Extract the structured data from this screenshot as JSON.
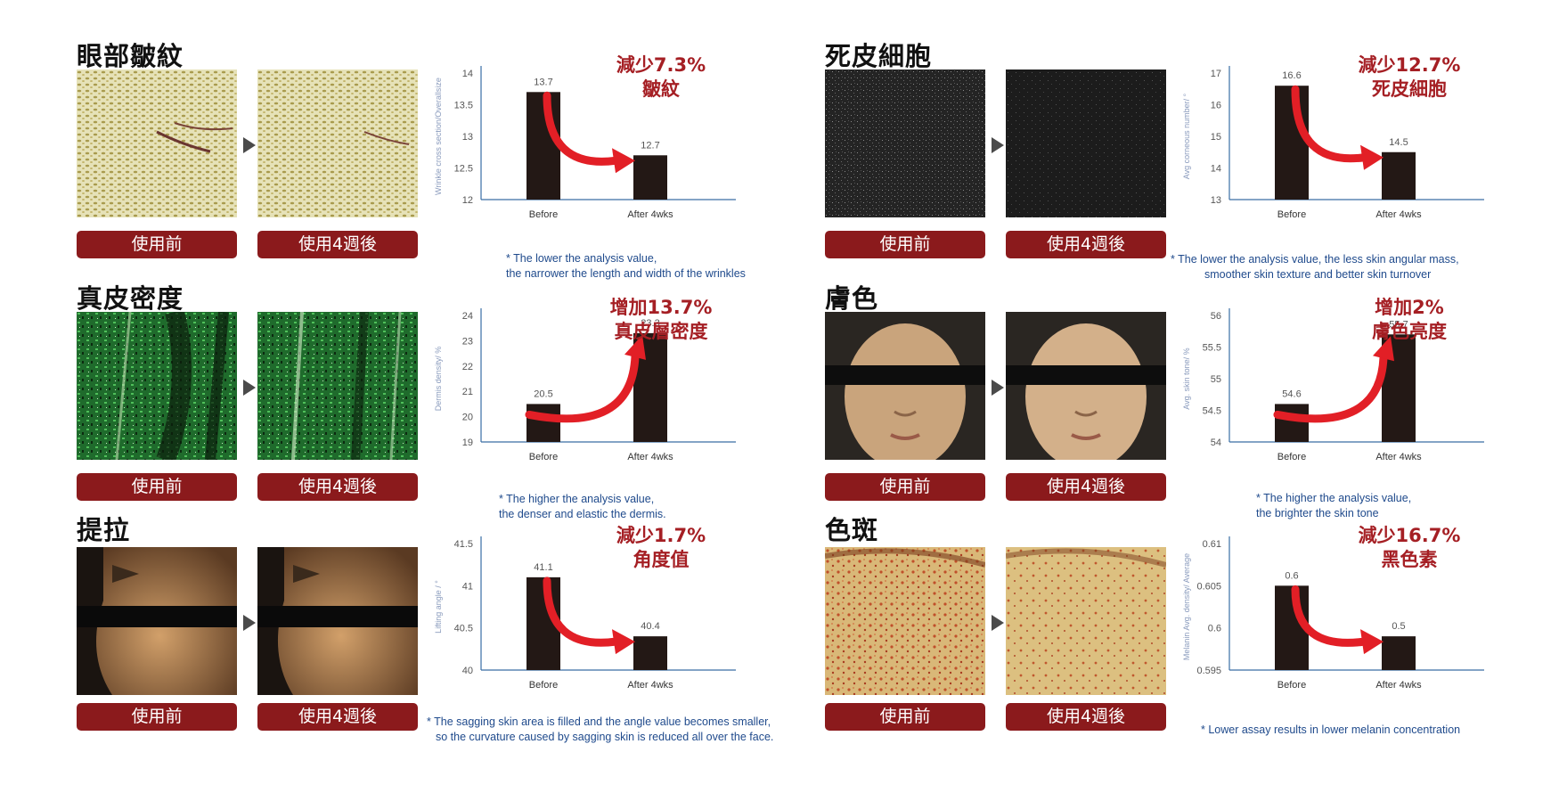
{
  "panels": [
    {
      "title": "眼部皺紋",
      "before_label": "使用前",
      "after_label": "使用4週後",
      "note": [
        "* The lower the analysis value,",
        "the narrower the length and width of the wrinkles"
      ]
    },
    {
      "title": "死皮細胞",
      "before_label": "使用前",
      "after_label": "使用4週後",
      "note": [
        "* The lower the analysis value, the less skin angular mass,",
        "smoother skin texture and better skin turnover"
      ]
    },
    {
      "title": "真皮密度",
      "before_label": "使用前",
      "after_label": "使用4週後",
      "note": [
        "* The higher the analysis value,",
        "the denser and elastic the dermis."
      ]
    },
    {
      "title": "膚色",
      "before_label": "使用前",
      "after_label": "使用4週後",
      "note": [
        "* The higher the analysis value,",
        "the brighter the skin tone"
      ]
    },
    {
      "title": "提拉",
      "before_label": "使用前",
      "after_label": "使用4週後",
      "note": [
        "* The sagging skin area is filled and the angle value becomes smaller,",
        "so the curvature caused by sagging skin is reduced all over the face."
      ]
    },
    {
      "title": "色斑",
      "before_label": "使用前",
      "after_label": "使用4週後",
      "note": [
        "* Lower assay results in lower melanin concentration"
      ]
    }
  ],
  "chart_data": [
    {
      "type": "bar",
      "categories": [
        "Before",
        "After 4wks"
      ],
      "values": [
        13.7,
        12.7
      ],
      "ylabel": "Wrinkle cross section/Overallsize",
      "ylim": [
        12,
        14
      ],
      "yticks": [
        12,
        12.5,
        13,
        13.5,
        14
      ],
      "value_labels": [
        "13.7",
        "12.7"
      ],
      "highlight": [
        "減少7.3%",
        "皺紋"
      ],
      "direction": "down"
    },
    {
      "type": "bar",
      "categories": [
        "Before",
        "After 4wks"
      ],
      "values": [
        16.6,
        14.5
      ],
      "ylabel": "Avg corneous number/ °",
      "ylim": [
        13,
        17
      ],
      "yticks": [
        13,
        14,
        15,
        16,
        17
      ],
      "value_labels": [
        "16.6",
        "14.5"
      ],
      "highlight": [
        "減少12.7%",
        "死皮細胞"
      ],
      "direction": "down"
    },
    {
      "type": "bar",
      "categories": [
        "Before",
        "After 4wks"
      ],
      "values": [
        20.5,
        23.3
      ],
      "ylabel": "Dermis density/ %",
      "ylim": [
        19,
        24
      ],
      "yticks": [
        19,
        20,
        21,
        22,
        23,
        24
      ],
      "value_labels": [
        "20.5",
        "23.3"
      ],
      "highlight": [
        "增加13.7%",
        "真皮層密度"
      ],
      "direction": "up"
    },
    {
      "type": "bar",
      "categories": [
        "Before",
        "After 4wks"
      ],
      "values": [
        54.6,
        55.7
      ],
      "ylabel": "Avg. skin tone/ %",
      "ylim": [
        54,
        56
      ],
      "yticks": [
        54,
        54.5,
        55,
        55.5,
        56
      ],
      "value_labels": [
        "54.6",
        "55.7"
      ],
      "highlight": [
        "增加2%",
        "膚色亮度"
      ],
      "direction": "up"
    },
    {
      "type": "bar",
      "categories": [
        "Before",
        "After 4wks"
      ],
      "values": [
        41.1,
        40.4
      ],
      "ylabel": "Lifting angle / °",
      "ylim": [
        40,
        41.5
      ],
      "yticks": [
        40,
        40.5,
        41,
        41.5
      ],
      "value_labels": [
        "41.1",
        "40.4"
      ],
      "highlight": [
        "減少1.7%",
        "角度值"
      ],
      "direction": "down"
    },
    {
      "type": "bar",
      "categories": [
        "Before",
        "After 4wks"
      ],
      "values": [
        0.605,
        0.599
      ],
      "ylabel": "Melanin Avg. density/ Average",
      "ylim": [
        0.595,
        0.61
      ],
      "yticks": [
        0.595,
        0.6,
        0.605,
        0.61
      ],
      "value_labels": [
        "0.6",
        "0.5"
      ],
      "highlight": [
        "減少16.7%",
        "黑色素"
      ],
      "direction": "down"
    }
  ],
  "colors": {
    "bar": "#231815",
    "arrow": "#e21f26",
    "highlight": "#a51f24",
    "button": "#8b1a1c",
    "note": "#1f4a8c",
    "axis": "#3a6ea5"
  }
}
